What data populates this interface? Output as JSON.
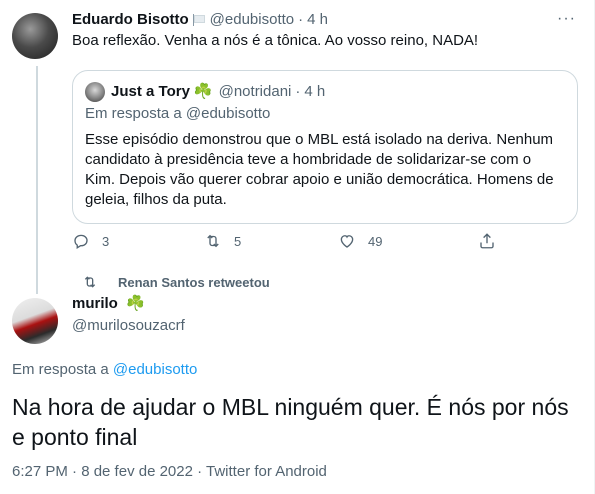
{
  "tweet1": {
    "name": "Eduardo Bisotto",
    "handle": "@edubisotto",
    "time": "4 h",
    "more": "···",
    "text": "Boa reflexão. Venha a nós é a tônica. Ao vosso reino, NADA!",
    "quote": {
      "name": "Just a Tory",
      "emoji": "☘️",
      "handle": "@notridani",
      "time": "4 h",
      "reply_prefix": "Em resposta a ",
      "reply_handle": "@edubisotto",
      "text": "Esse episódio demonstrou que o MBL está isolado na deriva. Nenhum candidato à presidência teve a hombridade de solidarizar-se com o Kim. Depois vão querer cobrar apoio e união democrática. Homens de geleia, filhos da puta."
    },
    "actions": {
      "replies": "3",
      "retweets": "5",
      "likes": "49"
    }
  },
  "retweet_notice": "Renan Santos retweetou",
  "tweet2": {
    "name": "murilo",
    "emoji": "☘️",
    "handle": "@murilosouzacrf",
    "reply_prefix": "Em resposta a ",
    "reply_handle": "@edubisotto",
    "text": "Na hora de ajudar o MBL ninguém quer. É nós por nós e ponto final",
    "timestamp": "6:27 PM · 8 de fev de 2022 · Twitter for Android"
  },
  "icons": {
    "reply": "reply-icon",
    "retweet": "retweet-icon",
    "like": "heart-icon",
    "share": "share-icon",
    "flag": "flag-icon"
  },
  "colors": {
    "text": "#0f1419",
    "muted": "#536471",
    "link": "#1d9bf0",
    "border": "#cfd9de",
    "shamrock": "#17a34a"
  }
}
